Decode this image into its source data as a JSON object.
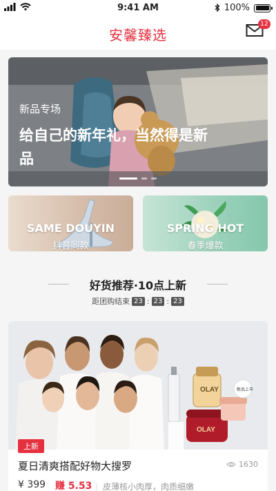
{
  "status": {
    "time": "9:41 AM",
    "battery": "100%",
    "battery_level": 1.0
  },
  "header": {
    "title": "安馨臻选",
    "mail_badge": "12"
  },
  "banner": {
    "tag": "新品专场",
    "title": "给自己的新年礼，当然得是新品",
    "active_index": 0
  },
  "cards": [
    {
      "en": "SAME DOUYIN",
      "cn": "抖音同款"
    },
    {
      "en": "SPRING HOT",
      "cn": "春季爆款"
    }
  ],
  "section": {
    "title": "好货推荐·10点上新",
    "countdown_label": "距团购结束",
    "hours": "23",
    "minutes": "23",
    "seconds": "23"
  },
  "product": {
    "tag": "上新",
    "title": "夏日清爽搭配好物大搜罗",
    "views": "1630",
    "price": "¥ 399",
    "earn": "赚 5.53",
    "desc": "皮薄核小肉厚，肉质细嫩",
    "img_brand": "OLAY",
    "img_badge": "新品上市"
  },
  "colors": {
    "accent": "#e5303f"
  }
}
